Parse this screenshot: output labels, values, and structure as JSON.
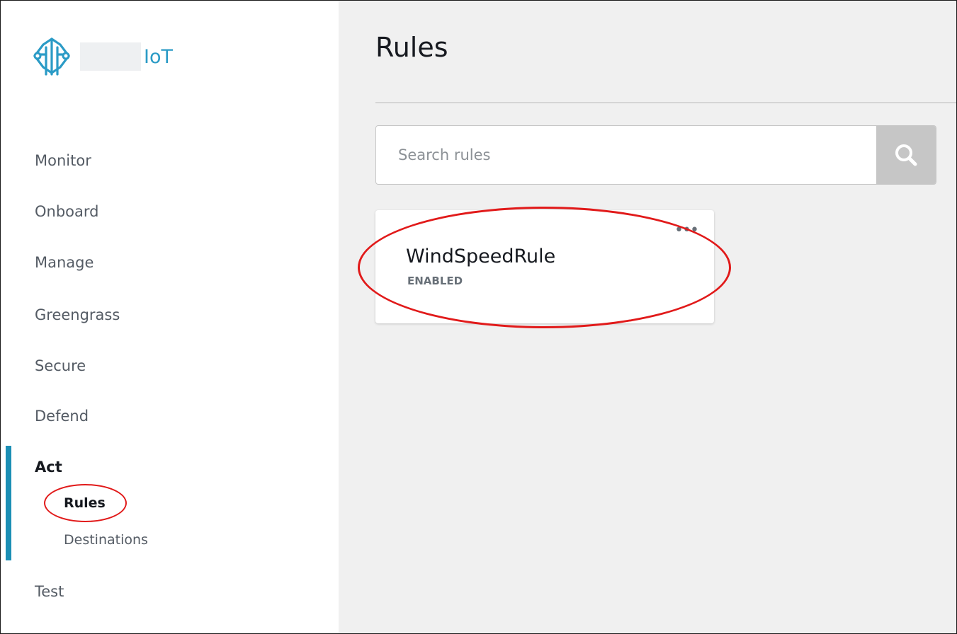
{
  "sidebar": {
    "logo_text": "IoT",
    "nav": {
      "monitor": "Monitor",
      "onboard": "Onboard",
      "manage": "Manage",
      "greengrass": "Greengrass",
      "secure": "Secure",
      "defend": "Defend",
      "act": "Act",
      "act_sub": {
        "rules": "Rules",
        "destinations": "Destinations"
      },
      "test": "Test"
    },
    "active_item": "Rules"
  },
  "main": {
    "title": "Rules",
    "search": {
      "placeholder": "Search rules",
      "value": ""
    },
    "rules": [
      {
        "name": "WindSpeedRule",
        "status": "ENABLED",
        "menu": "•••"
      }
    ]
  },
  "colors": {
    "accent": "#1b8fb5",
    "logo": "#2b9bc6",
    "annotation": "#e11a1a"
  },
  "icons": [
    "iot-logo-icon",
    "search-icon",
    "more-options-icon"
  ]
}
